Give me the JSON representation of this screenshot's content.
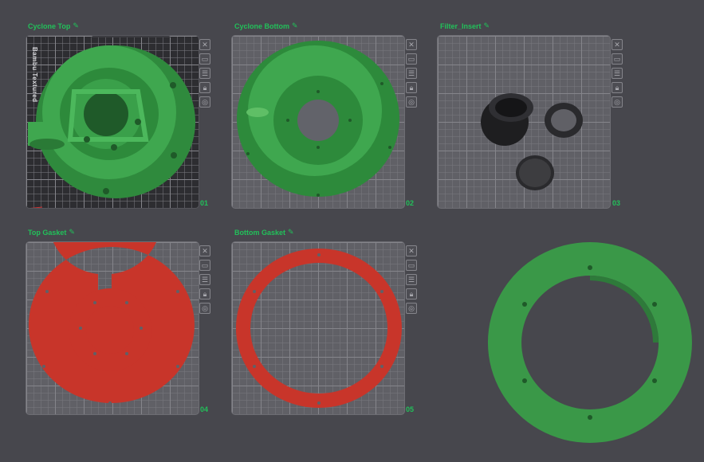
{
  "plates": [
    {
      "title": "Cyclone Top",
      "number": "01",
      "brand": "Bambu Textured"
    },
    {
      "title": "Cyclone Bottom",
      "number": "02"
    },
    {
      "title": "Filter_Insert",
      "number": "03"
    },
    {
      "title": "Top Gasket",
      "number": "04"
    },
    {
      "title": "Bottom Gasket",
      "number": "05"
    }
  ],
  "tools": [
    "close-icon",
    "image-icon",
    "arrange-icon",
    "lock-icon",
    "settings-icon"
  ],
  "colors": {
    "accent": "#22c05a",
    "part_green": "#3aa04c",
    "gasket_red": "#c8352a",
    "filter_black": "#2a2a2a",
    "background": "#47474d"
  }
}
